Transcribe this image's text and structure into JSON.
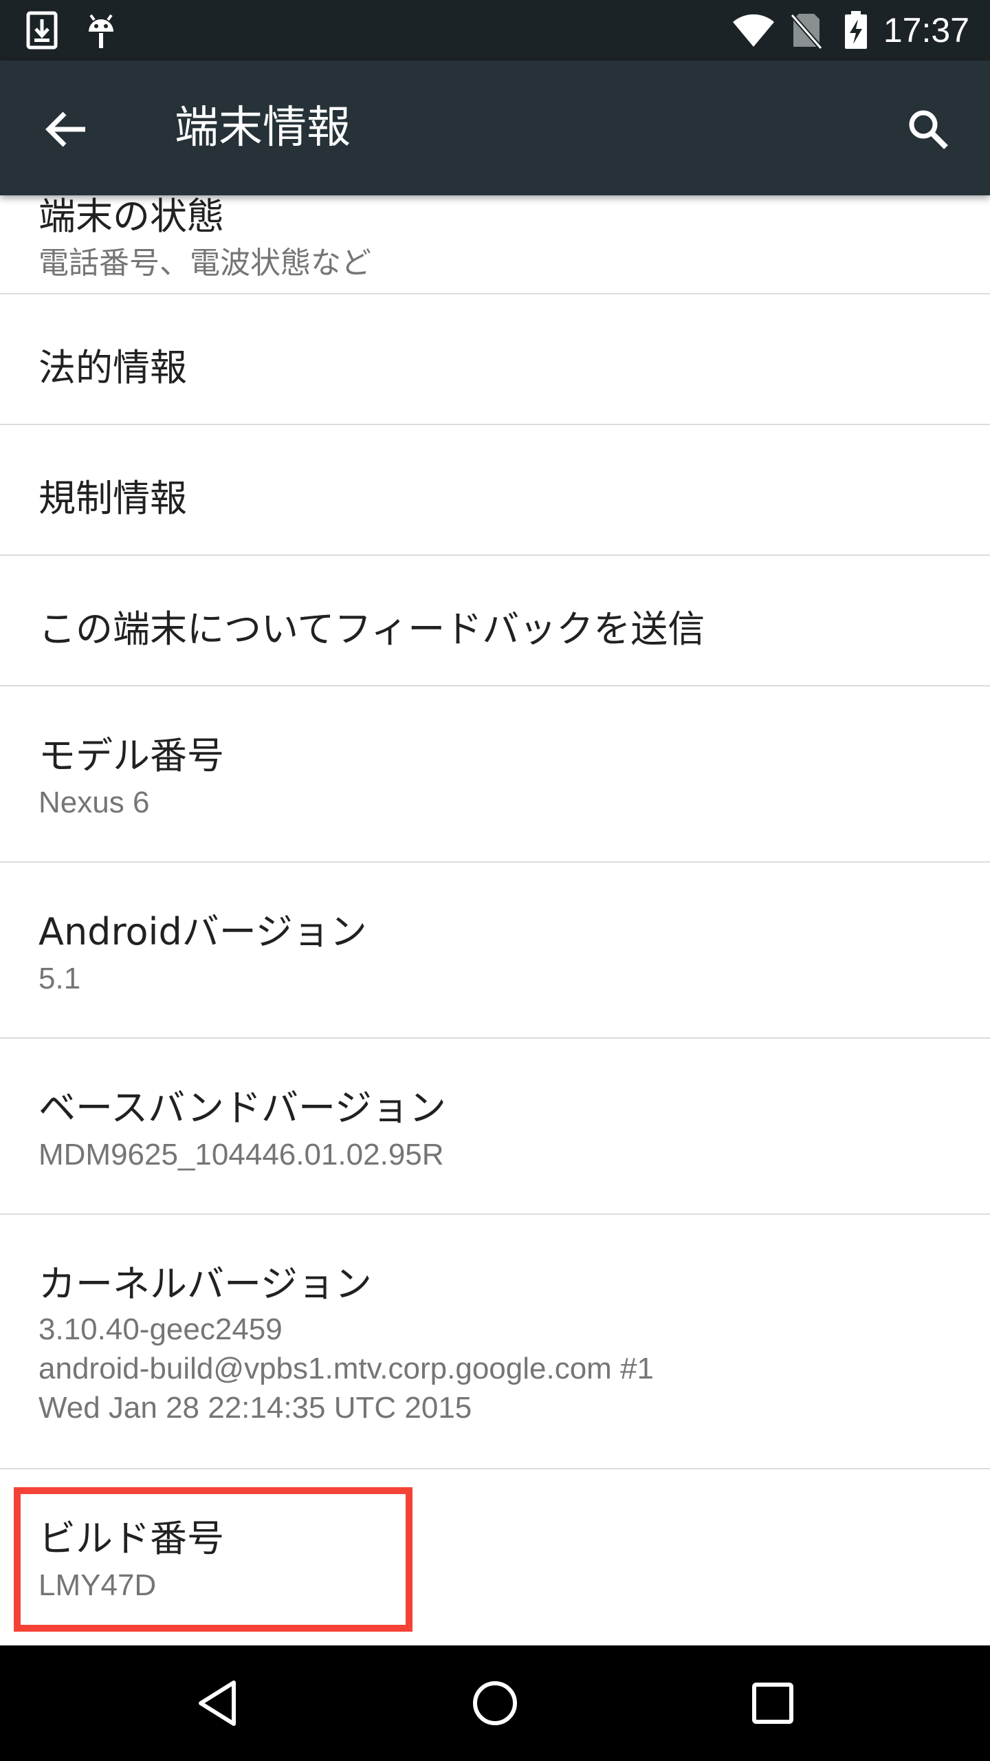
{
  "status_bar": {
    "time": "17:37",
    "icons": [
      "download-notification-icon",
      "android-debug-icon",
      "wifi-icon",
      "no-sim-icon",
      "battery-charging-icon"
    ]
  },
  "app_bar": {
    "title": "端末情報",
    "back_icon": "arrow-back-icon",
    "search_icon": "search-icon"
  },
  "list": {
    "items": [
      {
        "primary": "端末の状態",
        "secondary": "電話番号、電波状態など"
      },
      {
        "primary": "法的情報"
      },
      {
        "primary": "規制情報"
      },
      {
        "primary": "この端末についてフィードバックを送信"
      },
      {
        "primary": "モデル番号",
        "secondary": "Nexus 6"
      },
      {
        "primary": "Androidバージョン",
        "secondary": "5.1"
      },
      {
        "primary": "ベースバンドバージョン",
        "secondary": "MDM9625_104446.01.02.95R"
      },
      {
        "primary": "カーネルバージョン",
        "secondary_lines": [
          "3.10.40-geec2459",
          "android-build@vpbs1.mtv.corp.google.com #1",
          "Wed Jan 28 22:14:35 UTC 2015"
        ]
      },
      {
        "primary": "ビルド番号",
        "secondary": "LMY47D"
      }
    ]
  },
  "highlight": {
    "color": "#f44336",
    "target": "ビルド番号"
  },
  "nav_bar": {
    "icons": [
      "nav-back-icon",
      "nav-home-icon",
      "nav-recents-icon"
    ]
  },
  "colors": {
    "status_bar": "#1c2326",
    "app_bar": "#263238",
    "divider": "#dcdcdc",
    "primary_text": "#212121",
    "secondary_text": "#757575"
  }
}
